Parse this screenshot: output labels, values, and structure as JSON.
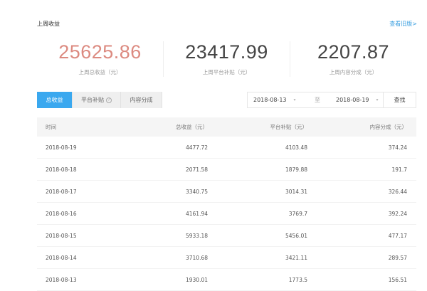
{
  "header": {
    "title": "上周收益",
    "old_version_link": "查看旧版>"
  },
  "stats": [
    {
      "value": "25625.86",
      "label": "上周总收益（元）"
    },
    {
      "value": "23417.99",
      "label": "上周平台补贴（元）"
    },
    {
      "value": "2207.87",
      "label": "上周内容分成（元）"
    }
  ],
  "tabs": [
    {
      "label": "总收益"
    },
    {
      "label": "平台补贴"
    },
    {
      "label": "内容分成"
    }
  ],
  "help_icon": "?",
  "date_range": {
    "start": "2018-08-13",
    "separator": "至",
    "end": "2018-08-19",
    "caret": "▾",
    "search_label": "查找"
  },
  "table": {
    "columns": [
      "时间",
      "总收益（元）",
      "平台补贴（元）",
      "内容分成（元）"
    ],
    "rows": [
      [
        "2018-08-19",
        "4477.72",
        "4103.48",
        "374.24"
      ],
      [
        "2018-08-18",
        "2071.58",
        "1879.88",
        "191.7"
      ],
      [
        "2018-08-17",
        "3340.75",
        "3014.31",
        "326.44"
      ],
      [
        "2018-08-16",
        "4161.94",
        "3769.7",
        "392.24"
      ],
      [
        "2018-08-15",
        "5933.18",
        "5456.01",
        "477.17"
      ],
      [
        "2018-08-14",
        "3710.68",
        "3421.11",
        "289.57"
      ],
      [
        "2018-08-13",
        "1930.01",
        "1773.5",
        "156.51"
      ]
    ]
  },
  "colors": {
    "accent": "#3aa8ef",
    "total": "#dc8a80"
  }
}
